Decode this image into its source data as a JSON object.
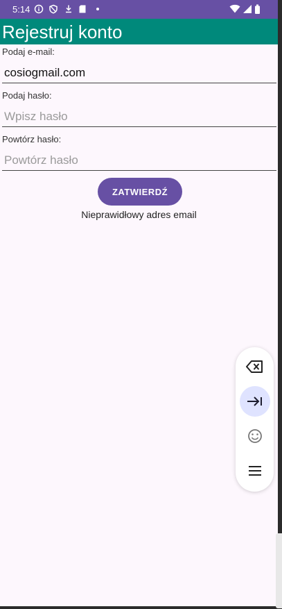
{
  "status_bar": {
    "time": "5:14"
  },
  "app_bar": {
    "title": "Rejestruj konto"
  },
  "form": {
    "email_label": "Podaj e-mail:",
    "email_value": "cosiogmail.com",
    "password_label": "Podaj hasło:",
    "password_placeholder": "Wpisz hasło",
    "password_value": "",
    "repeat_label": "Powtórz hasło:",
    "repeat_placeholder": "Powtórz hasło",
    "repeat_value": "",
    "submit_label": "ZATWIERDŹ",
    "error_message": "Nieprawidłowy adres email"
  },
  "keyboard_toolbar": {
    "buttons": [
      "backspace-icon",
      "tab-icon",
      "emoji-icon",
      "menu-icon"
    ]
  },
  "colors": {
    "status_bar": "#6750a4",
    "app_bar": "#00897b",
    "button": "#6750a4",
    "background": "#fdf7fd"
  }
}
